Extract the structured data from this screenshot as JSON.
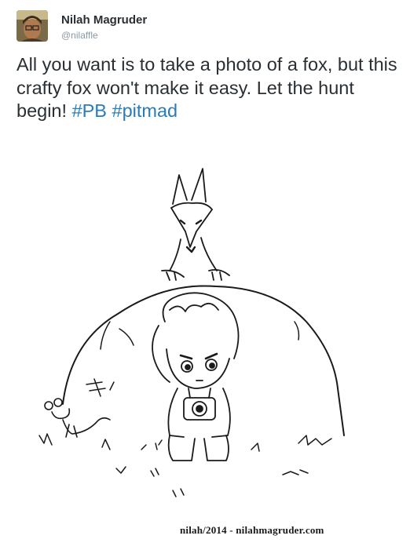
{
  "user": {
    "display_name": "Nilah Magruder",
    "handle": "@nilaffle",
    "avatar_icon": "profile-photo"
  },
  "tweet": {
    "text": "All you want is to take a photo of a fox, but this crafty fox won't make it easy. Let the hunt begin!",
    "hashtags": [
      "#PB",
      "#pitmad"
    ]
  },
  "image": {
    "caption_credit": "nilah/2014 - nilahmagruder.com"
  },
  "colors": {
    "text": "#292f33",
    "hashtag": "#2b7bb9",
    "handle": "#8899a6"
  }
}
